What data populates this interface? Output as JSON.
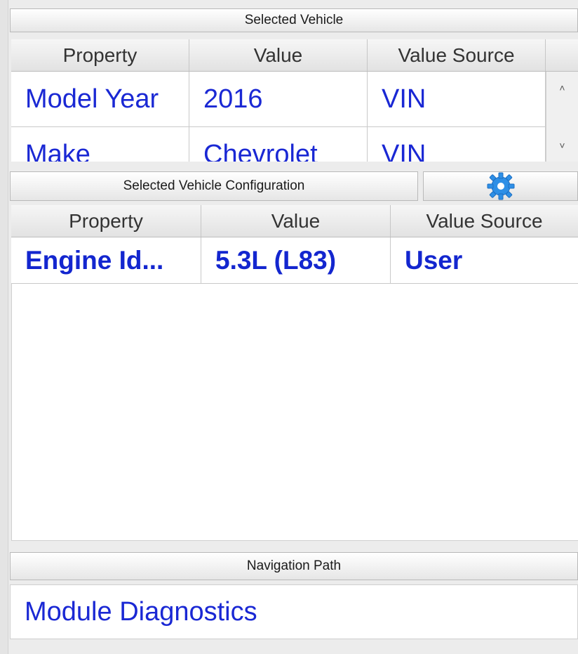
{
  "selected_vehicle": {
    "title": "Selected Vehicle",
    "columns": [
      "Property",
      "Value",
      "Value Source"
    ],
    "rows": [
      {
        "property": "Model Year",
        "value": "2016",
        "source": "VIN"
      },
      {
        "property": "Make",
        "value": "Chevrolet",
        "source": "VIN"
      }
    ],
    "scroll_up": "˄",
    "scroll_down": "˅"
  },
  "configuration": {
    "title": "Selected Vehicle Configuration",
    "gear_icon": "gear-icon",
    "columns": [
      "Property",
      "Value",
      "Value Source"
    ],
    "rows": [
      {
        "property": "Engine Id...",
        "value": "5.3L (L83)",
        "source": "User"
      }
    ]
  },
  "navigation": {
    "title": "Navigation Path",
    "path": "Module Diagnostics"
  },
  "colors": {
    "link_blue": "#1a28d4",
    "gear_blue": "#2e8fe6"
  }
}
